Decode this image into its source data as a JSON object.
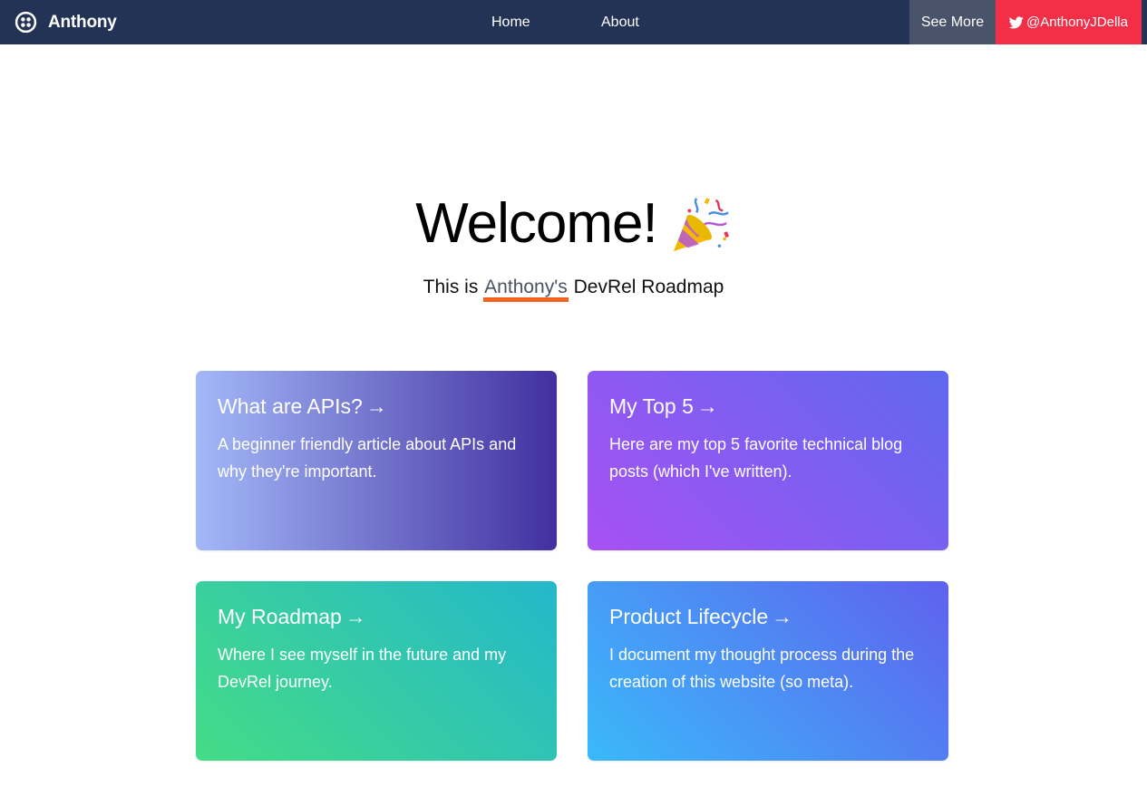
{
  "nav": {
    "brand": "Anthony",
    "links": [
      "Home",
      "About"
    ],
    "see_more": "See More",
    "twitter": "@AnthonyJDella"
  },
  "hero": {
    "title": "Welcome!",
    "subtitle_before": "This is",
    "subtitle_highlight": "Anthony's",
    "subtitle_after": "DevRel Roadmap"
  },
  "cards": [
    {
      "title": "What are APIs?",
      "arrow": "→",
      "description": "A beginner friendly article about APIs and why they're important."
    },
    {
      "title": "My Top 5",
      "arrow": "→",
      "description": "Here are my top 5 favorite technical blog posts (which I've written)."
    },
    {
      "title": "My Roadmap",
      "arrow": "→",
      "description": "Where I see myself in the future and my DevRel journey."
    },
    {
      "title": "Product Lifecycle",
      "arrow": "→",
      "description": "I document my thought process during the creation of this website (so meta)."
    }
  ],
  "colors": {
    "navbar": "#233355",
    "see_more_bg": "#49546b",
    "twitter_bg": "#f22f46",
    "highlight_underline": "#f26322"
  },
  "icons": {
    "brand": "twilio-logo-icon",
    "twitter": "twitter-bird-icon",
    "celebration": "party-popper-icon"
  }
}
